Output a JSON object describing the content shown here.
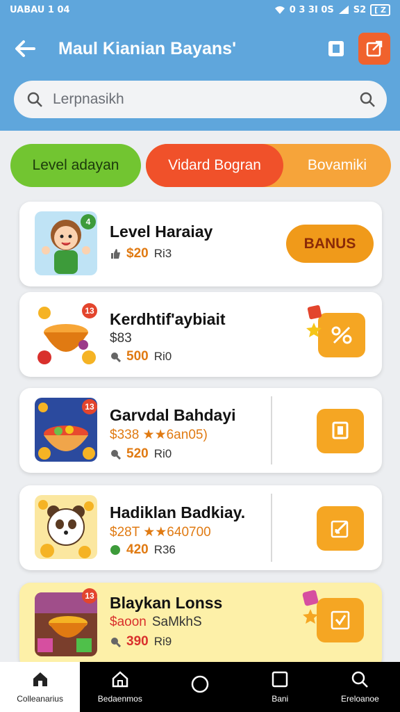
{
  "status": {
    "time": "UABAU 1 04",
    "signal_text": "0 3 3I 0S",
    "extra": "S2",
    "battery": "[ Z"
  },
  "header": {
    "title": "Maul Kianian Bayans'",
    "back_icon": "back-arrow-icon",
    "bookmark_icon": "bookmark-icon",
    "share_icon": "share-icon"
  },
  "search": {
    "placeholder": "Lerpnasikh"
  },
  "tabs": [
    {
      "label": "Level adayan",
      "color": "#72c531"
    },
    {
      "label": "Vidard Bogran",
      "color": "#f0512a"
    },
    {
      "label": "Bovamiki",
      "color": "#f6a43a"
    }
  ],
  "items": [
    {
      "name": "Level Haraiay",
      "badge": "4",
      "price": "$20",
      "unit": "Ri3",
      "action": "BANUS"
    },
    {
      "name": "Kerdhtif'aybiait",
      "badge": "13",
      "sub": "$83",
      "price": "500",
      "unit": "Ri0"
    },
    {
      "name": "Garvdal Bahdayi",
      "badge": "13",
      "sub": "$338 ★★6an05)",
      "price": "520",
      "unit": "Ri0"
    },
    {
      "name": "Hadiklan Badkiay.",
      "sub": "$28T ★★640700",
      "price": "420",
      "unit": "R36"
    },
    {
      "name": "Blaykan Lonss",
      "badge": "13",
      "sub": "$aoon",
      "sub2": "SaMkhS",
      "price": "390",
      "unit": "Ri9"
    }
  ],
  "nav": [
    {
      "label": "Colleanarius",
      "icon": "home-icon"
    },
    {
      "label": "Bedaenmos",
      "icon": "house-icon"
    },
    {
      "label": "",
      "icon": "circle-icon"
    },
    {
      "label": "Bani",
      "icon": "square-icon"
    },
    {
      "label": "Ereloanoe",
      "icon": "search-icon"
    }
  ],
  "colors": {
    "header_bg": "#5fa6dc",
    "accent_orange": "#f5a623",
    "price": "#e07a12"
  }
}
